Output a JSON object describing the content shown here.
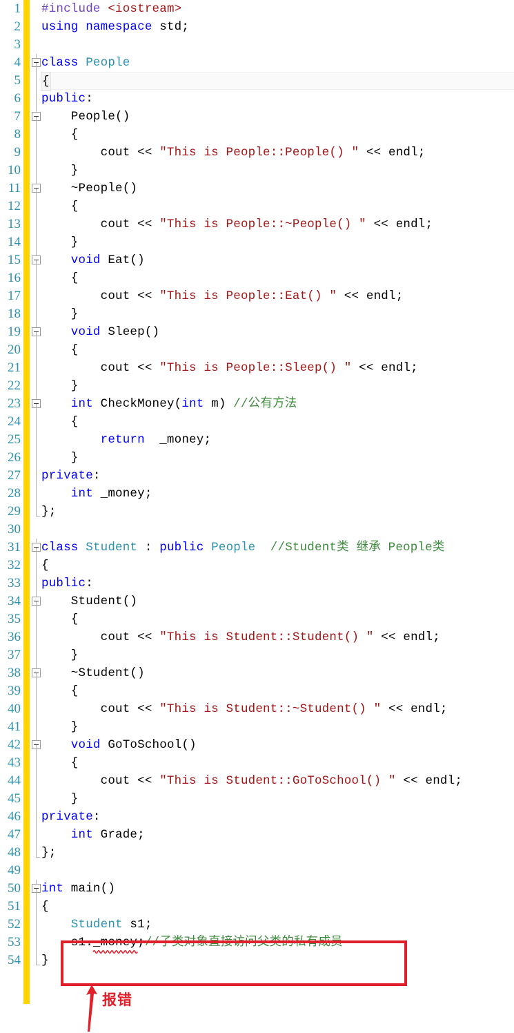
{
  "editor": {
    "language": "cpp",
    "gutter_changebar_color": "#FFD400",
    "line_number_color": "#2B91AF",
    "total_lines": 54,
    "colors": {
      "keyword": "#0000FF",
      "preprocessor": "#6F42C1",
      "type_name": "#2B91AF",
      "string": "#A31515",
      "comment": "#3E8B3E",
      "plain": "#000000",
      "error_accent": "#E0202A"
    },
    "lines": [
      {
        "n": "1",
        "fold": "none",
        "tokens": [
          {
            "t": "#include ",
            "c": "pre"
          },
          {
            "t": "<iostream>",
            "c": "str"
          }
        ]
      },
      {
        "n": "2",
        "fold": "none",
        "tokens": [
          {
            "t": "using namespace",
            "c": "kw"
          },
          {
            "t": " std;",
            "c": "plain"
          }
        ]
      },
      {
        "n": "3",
        "fold": "none",
        "tokens": []
      },
      {
        "n": "4",
        "fold": "box",
        "tokens": [
          {
            "t": "class ",
            "c": "kw"
          },
          {
            "t": "People",
            "c": "type"
          }
        ]
      },
      {
        "n": "5",
        "fold": "line",
        "band": true,
        "tokens": [
          {
            "t": "{",
            "c": "plain",
            "brace": true
          }
        ]
      },
      {
        "n": "6",
        "fold": "line",
        "tokens": [
          {
            "t": "public",
            "c": "kw"
          },
          {
            "t": ":",
            "c": "plain"
          }
        ]
      },
      {
        "n": "7",
        "fold": "box",
        "tokens": [
          {
            "t": "    People()",
            "c": "plain"
          }
        ]
      },
      {
        "n": "8",
        "fold": "line",
        "tokens": [
          {
            "t": "    {",
            "c": "plain"
          }
        ]
      },
      {
        "n": "9",
        "fold": "line",
        "tokens": [
          {
            "t": "        cout << ",
            "c": "plain"
          },
          {
            "t": "\"This is People::People() \"",
            "c": "str"
          },
          {
            "t": " << endl;",
            "c": "plain"
          }
        ]
      },
      {
        "n": "10",
        "fold": "line",
        "tokens": [
          {
            "t": "    }",
            "c": "plain"
          }
        ]
      },
      {
        "n": "11",
        "fold": "box",
        "tokens": [
          {
            "t": "    ~People()",
            "c": "plain"
          }
        ]
      },
      {
        "n": "12",
        "fold": "line",
        "tokens": [
          {
            "t": "    {",
            "c": "plain"
          }
        ]
      },
      {
        "n": "13",
        "fold": "line",
        "tokens": [
          {
            "t": "        cout << ",
            "c": "plain"
          },
          {
            "t": "\"This is People::~People() \"",
            "c": "str"
          },
          {
            "t": " << endl;",
            "c": "plain"
          }
        ]
      },
      {
        "n": "14",
        "fold": "line",
        "tokens": [
          {
            "t": "    }",
            "c": "plain"
          }
        ]
      },
      {
        "n": "15",
        "fold": "box",
        "tokens": [
          {
            "t": "    void",
            "c": "kw"
          },
          {
            "t": " Eat()",
            "c": "plain"
          }
        ]
      },
      {
        "n": "16",
        "fold": "line",
        "tokens": [
          {
            "t": "    {",
            "c": "plain"
          }
        ]
      },
      {
        "n": "17",
        "fold": "line",
        "tokens": [
          {
            "t": "        cout << ",
            "c": "plain"
          },
          {
            "t": "\"This is People::Eat() \"",
            "c": "str"
          },
          {
            "t": " << endl;",
            "c": "plain"
          }
        ]
      },
      {
        "n": "18",
        "fold": "line",
        "tokens": [
          {
            "t": "    }",
            "c": "plain"
          }
        ]
      },
      {
        "n": "19",
        "fold": "box",
        "tokens": [
          {
            "t": "    void",
            "c": "kw"
          },
          {
            "t": " Sleep()",
            "c": "plain"
          }
        ]
      },
      {
        "n": "20",
        "fold": "line",
        "tokens": [
          {
            "t": "    {",
            "c": "plain"
          }
        ]
      },
      {
        "n": "21",
        "fold": "line",
        "tokens": [
          {
            "t": "        cout << ",
            "c": "plain"
          },
          {
            "t": "\"This is People::Sleep() \"",
            "c": "str"
          },
          {
            "t": " << endl;",
            "c": "plain"
          }
        ]
      },
      {
        "n": "22",
        "fold": "line",
        "tokens": [
          {
            "t": "    }",
            "c": "plain"
          }
        ]
      },
      {
        "n": "23",
        "fold": "box",
        "tokens": [
          {
            "t": "    int",
            "c": "kw"
          },
          {
            "t": " CheckMoney(",
            "c": "plain"
          },
          {
            "t": "int",
            "c": "kw"
          },
          {
            "t": " m) ",
            "c": "plain"
          },
          {
            "t": "//公有方法",
            "c": "cmt"
          }
        ]
      },
      {
        "n": "24",
        "fold": "line",
        "tokens": [
          {
            "t": "    {",
            "c": "plain"
          }
        ]
      },
      {
        "n": "25",
        "fold": "line",
        "tokens": [
          {
            "t": "        return",
            "c": "kw"
          },
          {
            "t": "  _money;",
            "c": "plain"
          }
        ]
      },
      {
        "n": "26",
        "fold": "line",
        "tokens": [
          {
            "t": "    }",
            "c": "plain"
          }
        ]
      },
      {
        "n": "27",
        "fold": "line",
        "tokens": [
          {
            "t": "private",
            "c": "kw"
          },
          {
            "t": ":",
            "c": "plain"
          }
        ]
      },
      {
        "n": "28",
        "fold": "line",
        "tokens": [
          {
            "t": "    int",
            "c": "kw"
          },
          {
            "t": " _money;",
            "c": "plain"
          }
        ]
      },
      {
        "n": "29",
        "fold": "end",
        "tokens": [
          {
            "t": "};",
            "c": "plain"
          }
        ]
      },
      {
        "n": "30",
        "fold": "none",
        "tokens": []
      },
      {
        "n": "31",
        "fold": "box",
        "tokens": [
          {
            "t": "class ",
            "c": "kw"
          },
          {
            "t": "Student",
            "c": "type"
          },
          {
            "t": " : ",
            "c": "plain"
          },
          {
            "t": "public",
            "c": "kw"
          },
          {
            "t": " ",
            "c": "plain"
          },
          {
            "t": "People",
            "c": "type"
          },
          {
            "t": "  ",
            "c": "plain"
          },
          {
            "t": "//Student类 继承 People类",
            "c": "cmt"
          }
        ]
      },
      {
        "n": "32",
        "fold": "line",
        "tokens": [
          {
            "t": "{",
            "c": "plain"
          }
        ]
      },
      {
        "n": "33",
        "fold": "line",
        "tokens": [
          {
            "t": "public",
            "c": "kw"
          },
          {
            "t": ":",
            "c": "plain"
          }
        ]
      },
      {
        "n": "34",
        "fold": "box",
        "tokens": [
          {
            "t": "    Student()",
            "c": "plain"
          }
        ]
      },
      {
        "n": "35",
        "fold": "line",
        "tokens": [
          {
            "t": "    {",
            "c": "plain"
          }
        ]
      },
      {
        "n": "36",
        "fold": "line",
        "tokens": [
          {
            "t": "        cout << ",
            "c": "plain"
          },
          {
            "t": "\"This is Student::Student() \"",
            "c": "str"
          },
          {
            "t": " << endl;",
            "c": "plain"
          }
        ]
      },
      {
        "n": "37",
        "fold": "line",
        "tokens": [
          {
            "t": "    }",
            "c": "plain"
          }
        ]
      },
      {
        "n": "38",
        "fold": "box",
        "tokens": [
          {
            "t": "    ~Student()",
            "c": "plain"
          }
        ]
      },
      {
        "n": "39",
        "fold": "line",
        "tokens": [
          {
            "t": "    {",
            "c": "plain"
          }
        ]
      },
      {
        "n": "40",
        "fold": "line",
        "tokens": [
          {
            "t": "        cout << ",
            "c": "plain"
          },
          {
            "t": "\"This is Student::~Student() \"",
            "c": "str"
          },
          {
            "t": " << endl;",
            "c": "plain"
          }
        ]
      },
      {
        "n": "41",
        "fold": "line",
        "tokens": [
          {
            "t": "    }",
            "c": "plain"
          }
        ]
      },
      {
        "n": "42",
        "fold": "box",
        "tokens": [
          {
            "t": "    void",
            "c": "kw"
          },
          {
            "t": " GoToSchool()",
            "c": "plain"
          }
        ]
      },
      {
        "n": "43",
        "fold": "line",
        "tokens": [
          {
            "t": "    {",
            "c": "plain"
          }
        ]
      },
      {
        "n": "44",
        "fold": "line",
        "tokens": [
          {
            "t": "        cout << ",
            "c": "plain"
          },
          {
            "t": "\"This is Student::GoToSchool() \"",
            "c": "str"
          },
          {
            "t": " << endl;",
            "c": "plain"
          }
        ]
      },
      {
        "n": "45",
        "fold": "line",
        "tokens": [
          {
            "t": "    }",
            "c": "plain"
          }
        ]
      },
      {
        "n": "46",
        "fold": "line",
        "tokens": [
          {
            "t": "private",
            "c": "kw"
          },
          {
            "t": ":",
            "c": "plain"
          }
        ]
      },
      {
        "n": "47",
        "fold": "line",
        "tokens": [
          {
            "t": "    int",
            "c": "kw"
          },
          {
            "t": " Grade;",
            "c": "plain"
          }
        ]
      },
      {
        "n": "48",
        "fold": "end",
        "tokens": [
          {
            "t": "};",
            "c": "plain"
          }
        ]
      },
      {
        "n": "49",
        "fold": "none",
        "tokens": []
      },
      {
        "n": "50",
        "fold": "box",
        "tokens": [
          {
            "t": "int",
            "c": "kw"
          },
          {
            "t": " main()",
            "c": "plain"
          }
        ]
      },
      {
        "n": "51",
        "fold": "line",
        "tokens": [
          {
            "t": "{",
            "c": "plain"
          }
        ]
      },
      {
        "n": "52",
        "fold": "line",
        "tokens": [
          {
            "t": "    Student",
            "c": "type"
          },
          {
            "t": " s1;",
            "c": "plain"
          }
        ]
      },
      {
        "n": "53",
        "fold": "line",
        "tokens": [
          {
            "t": "    s1.",
            "c": "plain"
          },
          {
            "t": "_money",
            "c": "plain",
            "squiggle": true
          },
          {
            "t": ";",
            "c": "plain"
          },
          {
            "t": "//子类对象直接访问父类的私有成员",
            "c": "cmt"
          }
        ]
      },
      {
        "n": "54",
        "fold": "end",
        "tokens": [
          {
            "t": "}",
            "c": "plain"
          }
        ]
      }
    ]
  },
  "annotation": {
    "label": "报错",
    "color": "#E0202A",
    "highlight_lines": [
      "52",
      "53"
    ],
    "points_at": "_money"
  }
}
